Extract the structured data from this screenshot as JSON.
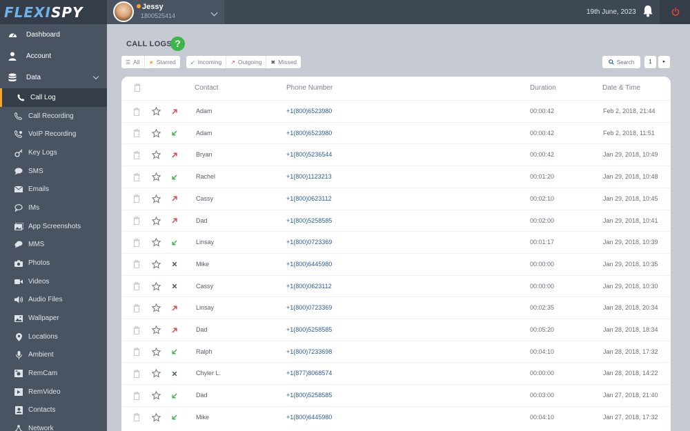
{
  "brand": {
    "logo_part1": "FLEXI",
    "logo_part2": "SPY"
  },
  "user": {
    "name": "Jessy",
    "phone": "1800525414"
  },
  "header": {
    "date": "19th June, 2023"
  },
  "sidebar": {
    "items": [
      {
        "label": "Dashboard",
        "icon": "dashboard-icon"
      },
      {
        "label": "Account",
        "icon": "user-icon"
      },
      {
        "label": "Data",
        "icon": "database-icon"
      },
      {
        "label": "Call Log",
        "icon": "phone-icon"
      },
      {
        "label": "Call Recording",
        "icon": "call-recording-icon"
      },
      {
        "label": "VoIP Recording",
        "icon": "voip-icon"
      },
      {
        "label": "Key Logs",
        "icon": "keyboard-icon"
      },
      {
        "label": "SMS",
        "icon": "sms-icon"
      },
      {
        "label": "Emails",
        "icon": "envelope-icon"
      },
      {
        "label": "IMs",
        "icon": "chat-icon"
      },
      {
        "label": "App Screenshots",
        "icon": "screenshot-icon"
      },
      {
        "label": "MMS",
        "icon": "mms-icon"
      },
      {
        "label": "Photos",
        "icon": "camera-icon"
      },
      {
        "label": "Videos",
        "icon": "video-icon"
      },
      {
        "label": "Audio Files",
        "icon": "speaker-icon"
      },
      {
        "label": "Wallpaper",
        "icon": "image-icon"
      },
      {
        "label": "Locations",
        "icon": "location-pin-icon"
      },
      {
        "label": "Ambient",
        "icon": "microphone-icon"
      },
      {
        "label": "RemCam",
        "icon": "remcam-icon"
      },
      {
        "label": "RemVideo",
        "icon": "remvideo-icon"
      },
      {
        "label": "Contacts",
        "icon": "contacts-icon"
      },
      {
        "label": "Network",
        "icon": "network-icon"
      }
    ]
  },
  "page": {
    "title": "CALL LOGS",
    "help": "?"
  },
  "filters": {
    "all": "All",
    "starred": "Starred",
    "incoming": "Incoming",
    "outgoing": "Outgoing",
    "missed": "Missed"
  },
  "toolbar": {
    "search_label": "Search",
    "page": "1",
    "next": "▸"
  },
  "table": {
    "headers": {
      "contact": "Contact",
      "phone": "Phone Number",
      "duration": "Duration",
      "datetime": "Date & Time"
    },
    "rows": [
      {
        "dir": "outgoing",
        "contact": "Adam",
        "phone": "+1(800)6523980",
        "duration": "00:00:42",
        "datetime": "Feb 2, 2018, 21:44"
      },
      {
        "dir": "incoming",
        "contact": "Adam",
        "phone": "+1(800)6523980",
        "duration": "00:00:42",
        "datetime": "Feb 2, 2018, 11:51"
      },
      {
        "dir": "outgoing",
        "contact": "Bryan",
        "phone": "+1(800)5236544",
        "duration": "00:00:42",
        "datetime": "Jan 29, 2018, 10:49"
      },
      {
        "dir": "incoming",
        "contact": "Rachel",
        "phone": "+1(800)1123213",
        "duration": "00:01:20",
        "datetime": "Jan 29, 2018, 10:48"
      },
      {
        "dir": "outgoing",
        "contact": "Cassy",
        "phone": "+1(800)0623112",
        "duration": "00:02:10",
        "datetime": "Jan 29, 2018, 10:45"
      },
      {
        "dir": "outgoing",
        "contact": "Dad",
        "phone": "+1(800)5258585",
        "duration": "00:02:00",
        "datetime": "Jan 29, 2018, 10:41"
      },
      {
        "dir": "incoming",
        "contact": "Linsay",
        "phone": "+1(800)0723369",
        "duration": "00:01:17",
        "datetime": "Jan 29, 2018, 10:39"
      },
      {
        "dir": "missed",
        "contact": "Mike",
        "phone": "+1(800)6445980",
        "duration": "00:00:00",
        "datetime": "Jan 29, 2018, 10:35"
      },
      {
        "dir": "missed",
        "contact": "Cassy",
        "phone": "+1(800)0623112",
        "duration": "00:00:00",
        "datetime": "Jan 29, 2018, 10:30"
      },
      {
        "dir": "outgoing",
        "contact": "Linsay",
        "phone": "+1(800)0723369",
        "duration": "00:02:35",
        "datetime": "Jan 28, 2018, 20:34"
      },
      {
        "dir": "outgoing",
        "contact": "Dad",
        "phone": "+1(800)5258585",
        "duration": "00:05:20",
        "datetime": "Jan 28, 2018, 18:34"
      },
      {
        "dir": "incoming",
        "contact": "Ralph",
        "phone": "+1(800)7233698",
        "duration": "00:04:10",
        "datetime": "Jan 28, 2018, 17:32"
      },
      {
        "dir": "missed",
        "contact": "Chyler L.",
        "phone": "+1(877)8068574",
        "duration": "00:00:00",
        "datetime": "Jan 28, 2018, 14:22"
      },
      {
        "dir": "incoming",
        "contact": "Dad",
        "phone": "+1(800)5258585",
        "duration": "00:03:00",
        "datetime": "Jan 27, 2018, 21:40"
      },
      {
        "dir": "incoming",
        "contact": "Mike",
        "phone": "+1(800)6445980",
        "duration": "00:04:10",
        "datetime": "Jan 27, 2018, 17:32"
      }
    ]
  },
  "colors": {
    "accent": "#f5a623",
    "incoming": "#3cb54a",
    "outgoing": "#e0443a",
    "missed": "#555d69",
    "link": "#2a5c9a"
  }
}
